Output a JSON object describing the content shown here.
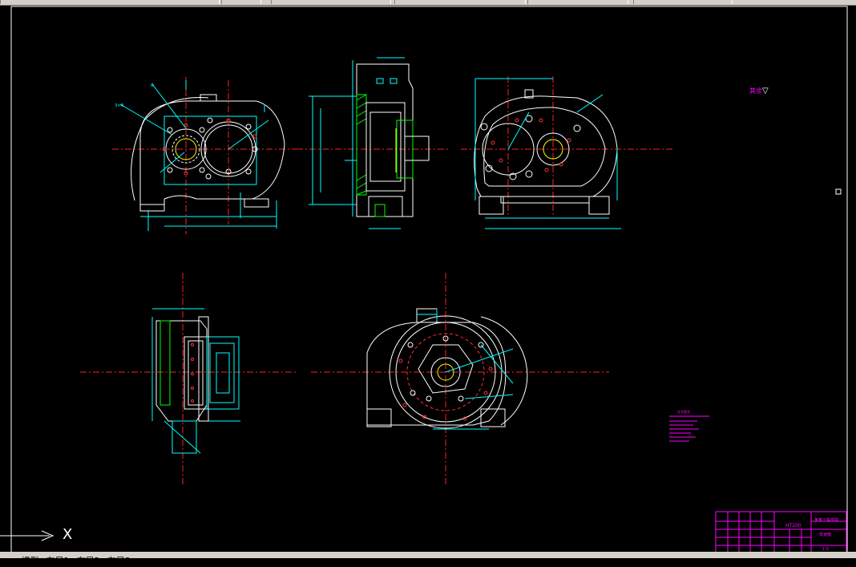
{
  "tabs": {
    "nav_arrows": [
      "◀",
      "▶"
    ],
    "model": "模型",
    "layout1": "布局1",
    "layout2": "布局2",
    "layout3": "布局3"
  },
  "ucs": {
    "x_label": "X"
  },
  "drawing": {
    "roughness_label": "其余",
    "roughness_symbol": "▽",
    "notes_title": "技术要求",
    "title_block": {
      "material": "HT200",
      "company": "某某工程学院",
      "part_name": "变速箱",
      "drawing_no": "1:5"
    }
  },
  "colors": {
    "background": "#000000",
    "outline": "#ffffff",
    "dimension": "#00ffff",
    "center": "#ff0000",
    "note": "#ff00ff",
    "hatch": "#00ff00",
    "wire": "#ffff00"
  }
}
